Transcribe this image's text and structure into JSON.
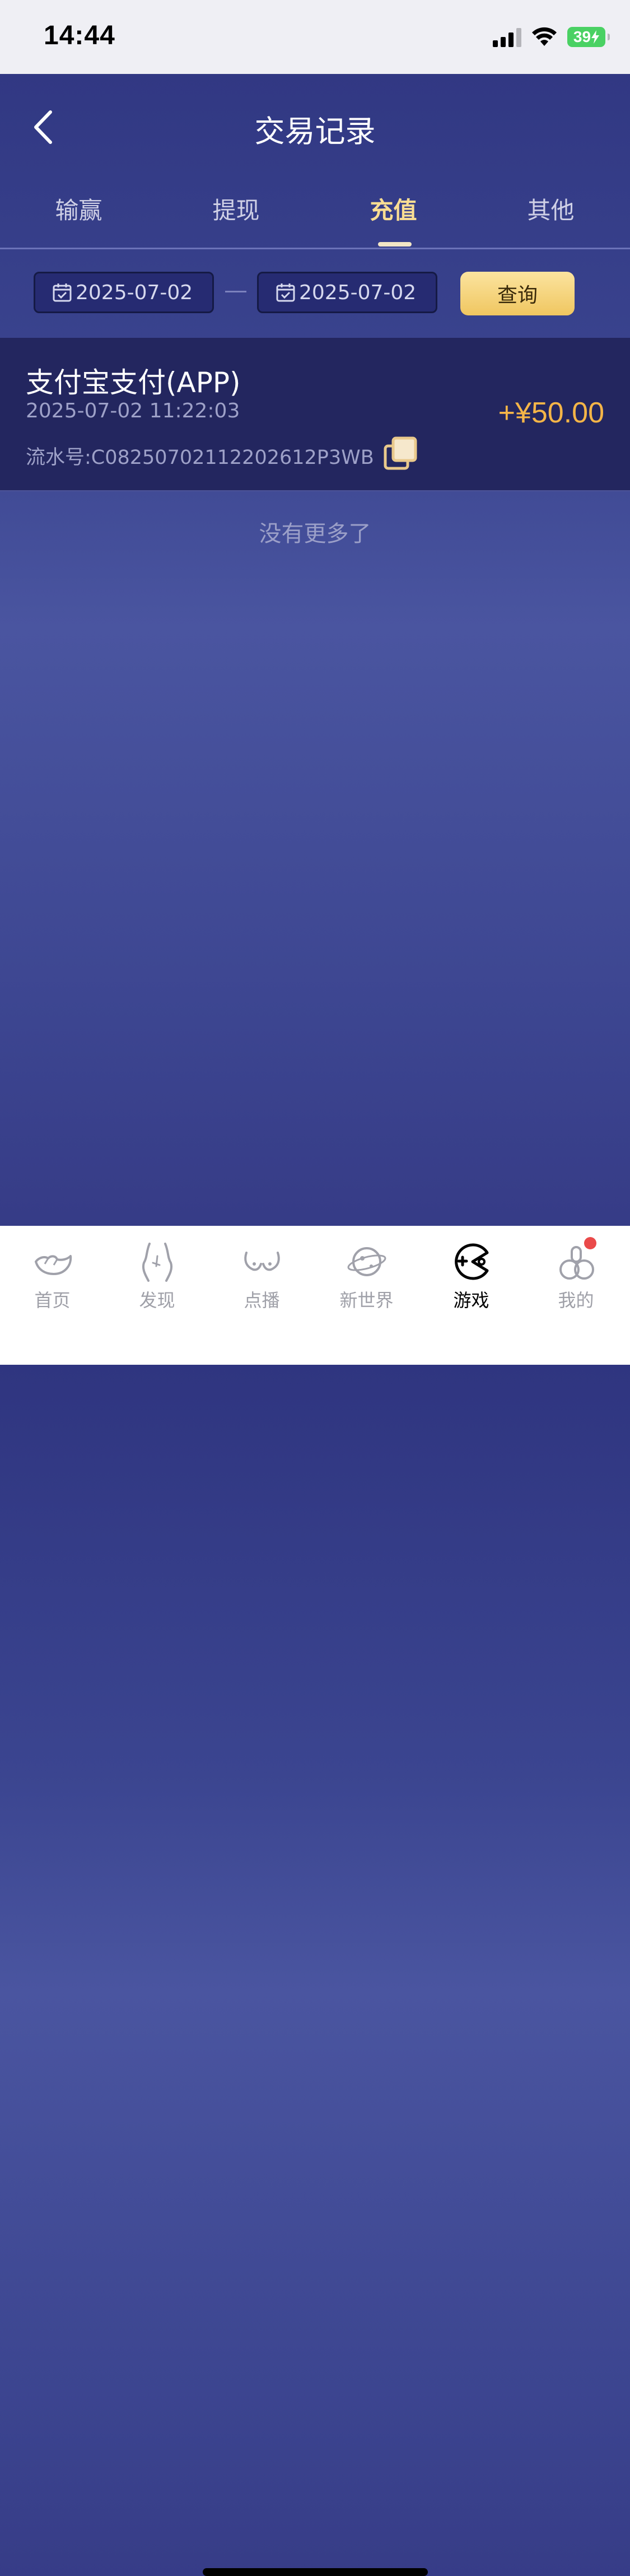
{
  "status_bar": {
    "time": "14:44",
    "battery": "39"
  },
  "nav": {
    "title": "交易记录"
  },
  "tabs": [
    {
      "label": "输赢"
    },
    {
      "label": "提现"
    },
    {
      "label": "充值"
    },
    {
      "label": "其他"
    }
  ],
  "active_tab": 2,
  "filter": {
    "start_date": "2025-07-02",
    "end_date": "2025-07-02",
    "query_label": "查询"
  },
  "records": [
    {
      "title": "支付宝支付(APP)",
      "time": "2025-07-02 11:22:03",
      "serial": "流水号:C08250702112202612P3WB",
      "amount": "+¥50.00"
    }
  ],
  "list_end_text": "没有更多了",
  "tabbar": {
    "items": [
      {
        "label": "首页",
        "icon": "hand-icon"
      },
      {
        "label": "发现",
        "icon": "figure-icon"
      },
      {
        "label": "点播",
        "icon": "bust-icon"
      },
      {
        "label": "新世界",
        "icon": "planet-icon"
      },
      {
        "label": "游戏",
        "icon": "game-icon"
      },
      {
        "label": "我的",
        "icon": "profile-icon"
      }
    ],
    "active_index": 4
  },
  "colors": {
    "accent_gold": "#f9dd93",
    "amount_orange": "#f4b548",
    "background_navy": "#2f3580"
  }
}
